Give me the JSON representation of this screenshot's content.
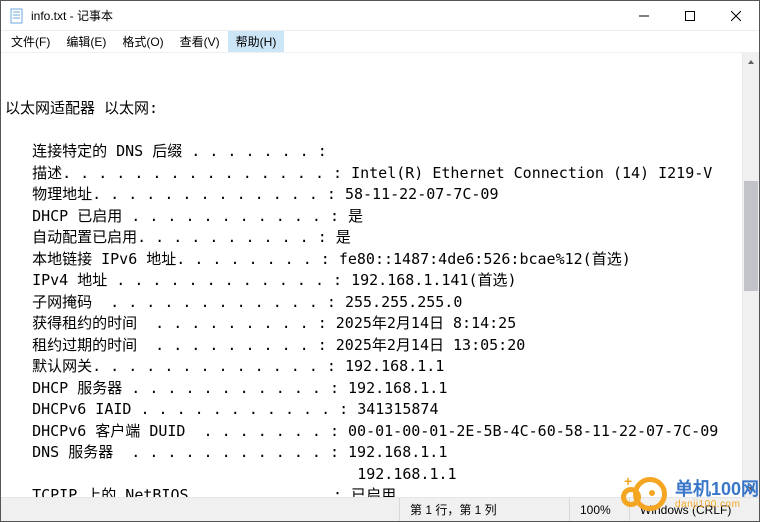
{
  "titlebar": {
    "title": "info.txt - 记事本"
  },
  "menu": {
    "items": [
      {
        "label": "文件(F)"
      },
      {
        "label": "编辑(E)"
      },
      {
        "label": "格式(O)"
      },
      {
        "label": "查看(V)"
      },
      {
        "label": "帮助(H)"
      }
    ],
    "active_index": 4
  },
  "document": {
    "lines": [
      "",
      "",
      "以太网适配器 以太网:",
      "",
      "   连接特定的 DNS 后缀 . . . . . . . :",
      "   描述. . . . . . . . . . . . . . . : Intel(R) Ethernet Connection (14) I219-V",
      "   物理地址. . . . . . . . . . . . . : 58-11-22-07-7C-09",
      "   DHCP 已启用 . . . . . . . . . . . : 是",
      "   自动配置已启用. . . . . . . . . . : 是",
      "   本地链接 IPv6 地址. . . . . . . . : fe80::1487:4de6:526:bcae%12(首选)",
      "   IPv4 地址 . . . . . . . . . . . . : 192.168.1.141(首选)",
      "   子网掩码  . . . . . . . . . . . . : 255.255.255.0",
      "   获得租约的时间  . . . . . . . . . : 2025年2月14日 8:14:25",
      "   租约过期的时间  . . . . . . . . . : 2025年2月14日 13:05:20",
      "   默认网关. . . . . . . . . . . . . : 192.168.1.1",
      "   DHCP 服务器 . . . . . . . . . . . : 192.168.1.1",
      "   DHCPv6 IAID . . . . . . . . . . . : 341315874",
      "   DHCPv6 客户端 DUID  . . . . . . . : 00-01-00-01-2E-5B-4C-60-58-11-22-07-7C-09",
      "   DNS 服务器  . . . . . . . . . . . : 192.168.1.1",
      "                                       192.168.1.1",
      "   TCPIP 上的 NetBIOS  . . . . . . . : 已启用"
    ]
  },
  "status": {
    "position": "第 1 行，第 1 列",
    "zoom": "100%",
    "lineending": "Windows (CRLF)"
  },
  "watermark": {
    "cn": "单机100网",
    "en": "danji100.com"
  }
}
